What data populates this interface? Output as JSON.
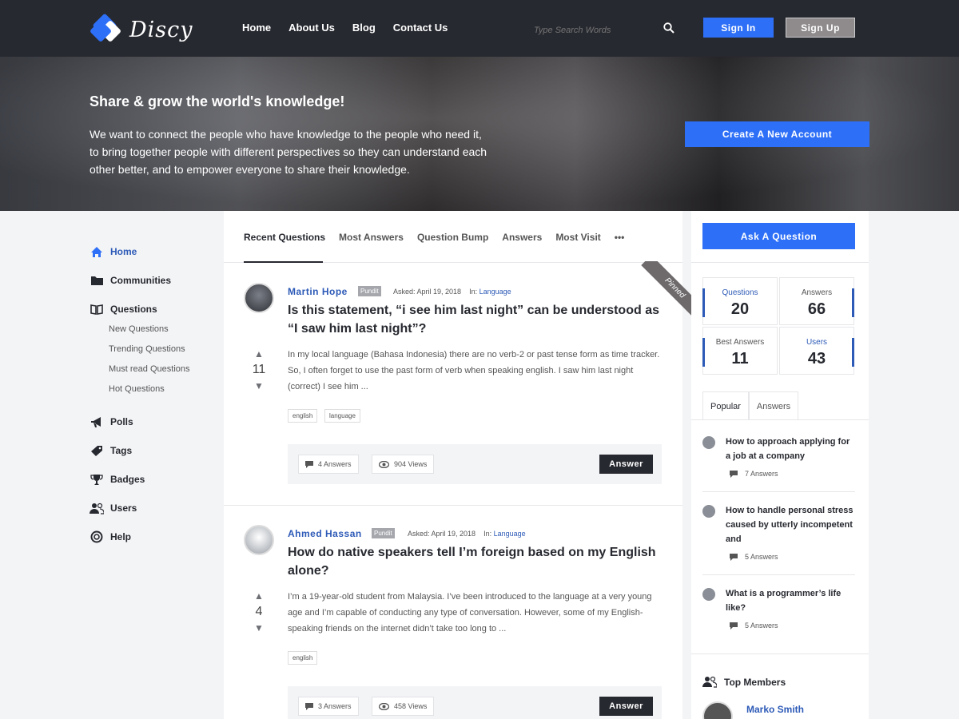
{
  "header": {
    "logo_text": "Discy",
    "nav": [
      "Home",
      "About Us",
      "Blog",
      "Contact Us"
    ],
    "search_placeholder": "Type Search Words",
    "signin": "Sign In",
    "signup": "Sign Up"
  },
  "hero": {
    "title": "Share & grow the world's knowledge!",
    "text": "We want to connect the people who have knowledge to the people who need it, to bring together people with different perspectives so they can understand each other better, and to empower everyone to share their knowledge.",
    "cta": "Create A New Account"
  },
  "sidebar": {
    "items": [
      {
        "label": "Home",
        "icon": "home-icon"
      },
      {
        "label": "Communities",
        "icon": "folder-icon"
      },
      {
        "label": "Questions",
        "icon": "book-icon"
      },
      {
        "label": "Polls",
        "icon": "megaphone-icon"
      },
      {
        "label": "Tags",
        "icon": "tag-icon"
      },
      {
        "label": "Badges",
        "icon": "trophy-icon"
      },
      {
        "label": "Users",
        "icon": "users-icon"
      },
      {
        "label": "Help",
        "icon": "lifebuoy-icon"
      }
    ],
    "subitems": [
      "New Questions",
      "Trending Questions",
      "Must read Questions",
      "Hot Questions"
    ]
  },
  "tabs": [
    "Recent Questions",
    "Most Answers",
    "Question Bump",
    "Answers",
    "Most Visit",
    "•••"
  ],
  "questions": [
    {
      "author": "Martin Hope",
      "badge": "Pundit",
      "asked": "Asked: April 19, 2018",
      "in_label": "In:",
      "category": "Language",
      "pinned": "Pinned",
      "title": "Is this statement, “i see him last night” can be understood as “I saw him last night”?",
      "excerpt": "In my local language (Bahasa Indonesia) there are no verb-2 or past tense form as time tracker. So, I often forget to use the past form of verb when speaking english. I saw him last night (correct) I see him ...",
      "votes": "11",
      "tags": [
        "english",
        "language"
      ],
      "answers": "4 Answers",
      "views": "904 Views",
      "answer_btn": "Answer"
    },
    {
      "author": "Ahmed Hassan",
      "badge": "Pundit",
      "asked": "Asked: April 19, 2018",
      "in_label": "In:",
      "category": "Language",
      "title": "How do native speakers tell I’m foreign based on my English alone?",
      "excerpt": "I’m a 19-year-old student from Malaysia. I’ve been introduced to the language at a very young age and I’m capable of conducting any type of conversation. However, some of my English-speaking friends on the internet didn’t take too long to ...",
      "votes": "4",
      "tags": [
        "english"
      ],
      "answers": "3 Answers",
      "views": "458 Views",
      "answer_btn": "Answer"
    }
  ],
  "right": {
    "ask": "Ask A Question",
    "stats": [
      {
        "label": "Questions",
        "value": "20"
      },
      {
        "label": "Answers",
        "value": "66"
      },
      {
        "label": "Best Answers",
        "value": "11"
      },
      {
        "label": "Users",
        "value": "43"
      }
    ],
    "tabs": [
      "Popular",
      "Answers"
    ],
    "popular": [
      {
        "title": "How to approach applying for a job at a company",
        "answers": "7 Answers"
      },
      {
        "title": "How to handle personal stress caused by utterly incompetent and",
        "answers": "5 Answers"
      },
      {
        "title": "What is a programmer’s life like?",
        "answers": "5 Answers"
      }
    ],
    "top_members": "Top Members",
    "member_name": "Marko Smith"
  },
  "colors": {
    "dark": "#272930",
    "accent": "#2d6ff7",
    "link": "#2d5ab7"
  }
}
